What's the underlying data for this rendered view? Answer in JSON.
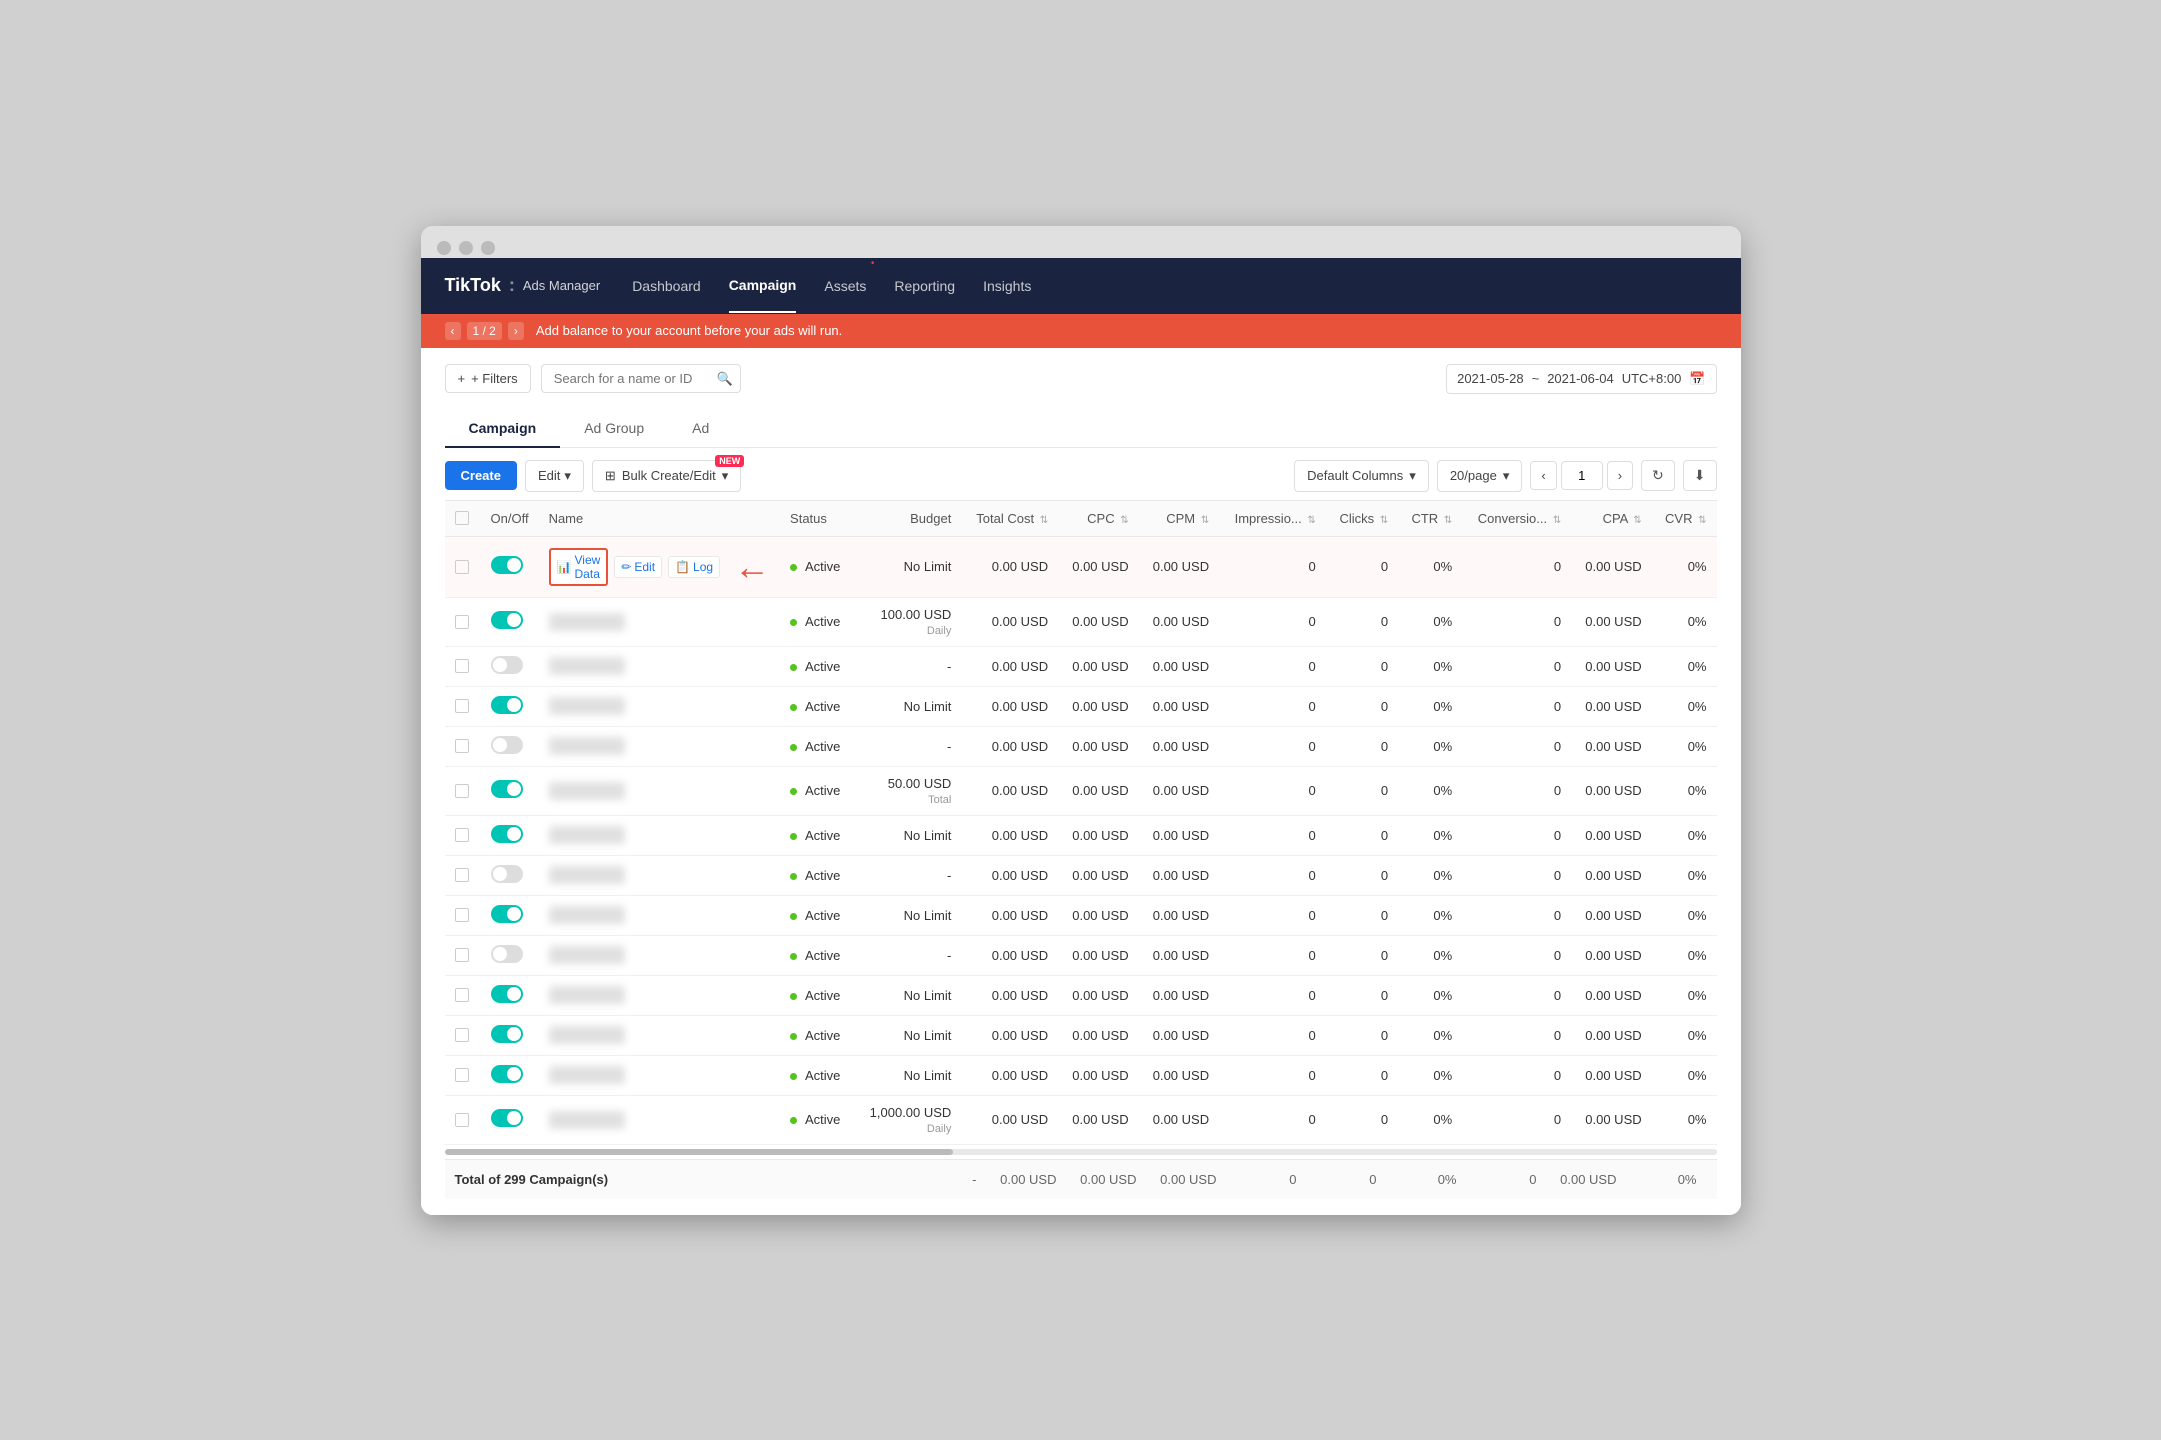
{
  "browser": {
    "dots": [
      "dot1",
      "dot2",
      "dot3"
    ]
  },
  "nav": {
    "logo": "TikTok",
    "logo_sep": ":",
    "logo_sub": "Ads Manager",
    "links": [
      {
        "label": "Dashboard",
        "active": false
      },
      {
        "label": "Campaign",
        "active": true
      },
      {
        "label": "Assets",
        "active": false,
        "badge": true
      },
      {
        "label": "Reporting",
        "active": false
      },
      {
        "label": "Insights",
        "active": false
      }
    ]
  },
  "alert": {
    "page_current": "1",
    "page_total": "2",
    "message": "Add balance to your account before your ads will run."
  },
  "toolbar": {
    "filters_label": "+ Filters",
    "search_placeholder": "Search for a name or ID",
    "date_start": "2021-05-28",
    "date_sep": "~",
    "date_end": "2021-06-04",
    "timezone": "UTC+8:00"
  },
  "tabs": [
    {
      "label": "Campaign",
      "active": true
    },
    {
      "label": "Ad Group",
      "active": false
    },
    {
      "label": "Ad",
      "active": false
    }
  ],
  "subtoolbar": {
    "create_label": "Create",
    "edit_label": "Edit",
    "bulk_label": "Bulk Create/Edit",
    "bulk_badge": "NEW",
    "columns_label": "Default Columns",
    "per_page_label": "20/page",
    "page_current": "1",
    "refresh_icon": "↻",
    "download_icon": "⬇"
  },
  "table": {
    "columns": [
      {
        "label": "On/Off",
        "sortable": false
      },
      {
        "label": "Name",
        "sortable": false
      },
      {
        "label": "Status",
        "sortable": false
      },
      {
        "label": "Budget",
        "sortable": false
      },
      {
        "label": "Total Cost",
        "sortable": true
      },
      {
        "label": "CPC",
        "sortable": true
      },
      {
        "label": "CPM",
        "sortable": true
      },
      {
        "label": "Impressio...",
        "sortable": true
      },
      {
        "label": "Clicks",
        "sortable": true
      },
      {
        "label": "CTR",
        "sortable": true
      },
      {
        "label": "Conversio...",
        "sortable": true
      },
      {
        "label": "CPA",
        "sortable": true
      },
      {
        "label": "CVR",
        "sortable": true
      }
    ],
    "rows": [
      {
        "on": true,
        "name": "highlighted",
        "status": "Active",
        "budget": "No Limit",
        "total_cost": "0.00 USD",
        "cpc": "0.00 USD",
        "cpm": "0.00 USD",
        "impressions": "0",
        "clicks": "0",
        "ctr": "0%",
        "conversions": "0",
        "cpa": "0.00 USD",
        "cvr": "0%",
        "show_actions": true
      },
      {
        "on": true,
        "name": "blurred1",
        "status": "Active",
        "budget": "100.00 USD\nDaily",
        "total_cost": "0.00 USD",
        "cpc": "0.00 USD",
        "cpm": "0.00 USD",
        "impressions": "0",
        "clicks": "0",
        "ctr": "0%",
        "conversions": "0",
        "cpa": "0.00 USD",
        "cvr": "0%"
      },
      {
        "on": false,
        "name": "blurred2",
        "status": "Active",
        "budget": "-",
        "total_cost": "0.00 USD",
        "cpc": "0.00 USD",
        "cpm": "0.00 USD",
        "impressions": "0",
        "clicks": "0",
        "ctr": "0%",
        "conversions": "0",
        "cpa": "0.00 USD",
        "cvr": "0%"
      },
      {
        "on": true,
        "name": "blurred3",
        "status": "Active",
        "budget": "No Limit",
        "total_cost": "0.00 USD",
        "cpc": "0.00 USD",
        "cpm": "0.00 USD",
        "impressions": "0",
        "clicks": "0",
        "ctr": "0%",
        "conversions": "0",
        "cpa": "0.00 USD",
        "cvr": "0%"
      },
      {
        "on": false,
        "name": "blurred4",
        "status": "Active",
        "budget": "-",
        "total_cost": "0.00 USD",
        "cpc": "0.00 USD",
        "cpm": "0.00 USD",
        "impressions": "0",
        "clicks": "0",
        "ctr": "0%",
        "conversions": "0",
        "cpa": "0.00 USD",
        "cvr": "0%"
      },
      {
        "on": true,
        "name": "blurred5",
        "status": "Active",
        "budget": "50.00 USD\nTotal",
        "total_cost": "0.00 USD",
        "cpc": "0.00 USD",
        "cpm": "0.00 USD",
        "impressions": "0",
        "clicks": "0",
        "ctr": "0%",
        "conversions": "0",
        "cpa": "0.00 USD",
        "cvr": "0%"
      },
      {
        "on": true,
        "name": "blurred6",
        "status": "Active",
        "budget": "No Limit",
        "total_cost": "0.00 USD",
        "cpc": "0.00 USD",
        "cpm": "0.00 USD",
        "impressions": "0",
        "clicks": "0",
        "ctr": "0%",
        "conversions": "0",
        "cpa": "0.00 USD",
        "cvr": "0%"
      },
      {
        "on": false,
        "name": "blurred7",
        "status": "Active",
        "budget": "-",
        "total_cost": "0.00 USD",
        "cpc": "0.00 USD",
        "cpm": "0.00 USD",
        "impressions": "0",
        "clicks": "0",
        "ctr": "0%",
        "conversions": "0",
        "cpa": "0.00 USD",
        "cvr": "0%"
      },
      {
        "on": true,
        "name": "blurred8",
        "status": "Active",
        "budget": "No Limit",
        "total_cost": "0.00 USD",
        "cpc": "0.00 USD",
        "cpm": "0.00 USD",
        "impressions": "0",
        "clicks": "0",
        "ctr": "0%",
        "conversions": "0",
        "cpa": "0.00 USD",
        "cvr": "0%"
      },
      {
        "on": false,
        "name": "blurred9",
        "status": "Active",
        "budget": "-",
        "total_cost": "0.00 USD",
        "cpc": "0.00 USD",
        "cpm": "0.00 USD",
        "impressions": "0",
        "clicks": "0",
        "ctr": "0%",
        "conversions": "0",
        "cpa": "0.00 USD",
        "cvr": "0%"
      },
      {
        "on": true,
        "name": "blurred10",
        "status": "Active",
        "budget": "No Limit",
        "total_cost": "0.00 USD",
        "cpc": "0.00 USD",
        "cpm": "0.00 USD",
        "impressions": "0",
        "clicks": "0",
        "ctr": "0%",
        "conversions": "0",
        "cpa": "0.00 USD",
        "cvr": "0%"
      },
      {
        "on": true,
        "name": "blurred11",
        "status": "Active",
        "budget": "No Limit",
        "total_cost": "0.00 USD",
        "cpc": "0.00 USD",
        "cpm": "0.00 USD",
        "impressions": "0",
        "clicks": "0",
        "ctr": "0%",
        "conversions": "0",
        "cpa": "0.00 USD",
        "cvr": "0%"
      },
      {
        "on": true,
        "name": "blurred12",
        "status": "Active",
        "budget": "No Limit",
        "total_cost": "0.00 USD",
        "cpc": "0.00 USD",
        "cpm": "0.00 USD",
        "impressions": "0",
        "clicks": "0",
        "ctr": "0%",
        "conversions": "0",
        "cpa": "0.00 USD",
        "cvr": "0%"
      },
      {
        "on": true,
        "name": "blurred13",
        "status": "Active",
        "budget": "1,000.00 USD\nDaily",
        "total_cost": "0.00 USD",
        "cpc": "0.00 USD",
        "cpm": "0.00 USD",
        "impressions": "0",
        "clicks": "0",
        "ctr": "0%",
        "conversions": "0",
        "cpa": "0.00 USD",
        "cvr": "0%"
      }
    ],
    "actions": {
      "view_data": "View Data",
      "edit": "Edit",
      "log": "Log"
    }
  },
  "footer": {
    "total_label": "Total of 299 Campaign(s)",
    "budget": "-",
    "total_cost": "0.00 USD",
    "cpc": "0.00 USD",
    "cpm": "0.00 USD",
    "impressions": "0",
    "clicks": "0",
    "ctr": "0%",
    "conversions": "0",
    "cpa": "0.00 USD",
    "cvr": "0%"
  }
}
